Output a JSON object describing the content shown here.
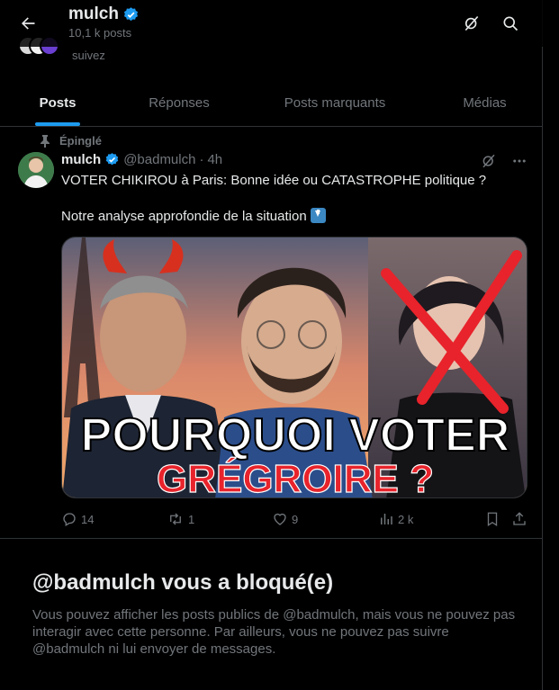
{
  "header": {
    "title": "mulch",
    "posts_count": "10,1 k posts",
    "peek_text": "suivez"
  },
  "tabs": [
    {
      "label": "Posts",
      "active": true
    },
    {
      "label": "Réponses",
      "active": false
    },
    {
      "label": "Posts marquants",
      "active": false
    },
    {
      "label": "Médias",
      "active": false
    }
  ],
  "post": {
    "pinned_label": "Épinglé",
    "author_name": "mulch",
    "handle": "@badmulch",
    "separator": "·",
    "time": "4h",
    "text_line1": "VOTER CHIKIROU à Paris: Bonne idée ou CATASTROPHE politique ?",
    "text_line2": "Notre analyse approfondie de la situation",
    "image_caption_line1": "POURQUOI VOTER",
    "image_caption_line2": "GRÉGROIRE ?",
    "stats": {
      "replies": "14",
      "reposts": "1",
      "likes": "9",
      "views": "2 k"
    }
  },
  "blocked": {
    "title": "@badmulch vous a bloqué(e)",
    "message": "Vous pouvez afficher les posts publics de @badmulch, mais vous ne pouvez pas interagir avec cette personne. Par ailleurs, vous ne pouvez pas suivre @badmulch ni lui envoyer de messages."
  },
  "colors": {
    "background": "#000000",
    "accent": "#1d9bf0",
    "text_primary": "#e7e9ea",
    "text_secondary": "#71767b",
    "border": "#2f3336",
    "caption_red": "#e8232b"
  }
}
